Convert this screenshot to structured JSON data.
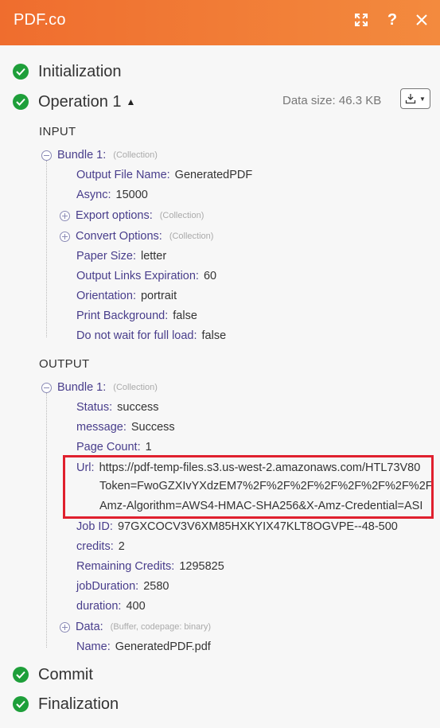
{
  "header": {
    "title": "PDF.co",
    "help_label": "?"
  },
  "steps": {
    "initialization": "Initialization",
    "operation": "Operation 1",
    "commit": "Commit",
    "finalization": "Finalization"
  },
  "operation": {
    "data_size": "Data size: 46.3 KB"
  },
  "input": {
    "section_label": "INPUT",
    "bundle_label": "Bundle 1:",
    "bundle_type": "(Collection)",
    "fields": [
      {
        "key": "Output File Name",
        "value": "GeneratedPDF"
      },
      {
        "key": "Async",
        "value": "15000"
      },
      {
        "key": "Export options",
        "type": "(Collection)"
      },
      {
        "key": "Convert Options",
        "type": "(Collection)"
      },
      {
        "key": "Paper Size ",
        "value": "letter"
      },
      {
        "key": "Output Links Expiration",
        "value": "60"
      },
      {
        "key": "Orientation",
        "value": "portrait"
      },
      {
        "key": "Print Background",
        "value": "false"
      },
      {
        "key": "Do not wait for full load",
        "value": "false"
      }
    ]
  },
  "output": {
    "section_label": "OUTPUT",
    "bundle_label": "Bundle 1:",
    "bundle_type": "(Collection)",
    "fields": [
      {
        "key": "Status",
        "value": "success"
      },
      {
        "key": "message",
        "value": "Success"
      },
      {
        "key": "Page Count",
        "value": "1"
      },
      {
        "key": "Url",
        "value": "https://pdf-temp-files.s3.us-west-2.amazonaws.com/HTL73V80"
      },
      {
        "key": "Job ID",
        "value": "97GXCOCV3V6XM85HXKYIX47KLT8OGVPE--48-500"
      },
      {
        "key": "credits",
        "value": "2"
      },
      {
        "key": "Remaining Credits",
        "value": "1295825"
      },
      {
        "key": "jobDuration",
        "value": "2580"
      },
      {
        "key": "duration",
        "value": "400"
      },
      {
        "key": "Data",
        "type": "(Buffer, codepage: binary)"
      },
      {
        "key": "Name",
        "value": "GeneratedPDF.pdf"
      }
    ],
    "url_continuation": [
      "Token=FwoGZXIvYXdzEM7%2F%2F%2F%2F%2F%2F%2F%2F%2",
      "Amz-Algorithm=AWS4-HMAC-SHA256&X-Amz-Credential=ASI"
    ]
  },
  "colors": {
    "header_start": "#ef6d2e",
    "header_end": "#f38a3e",
    "success": "#1e9f3a",
    "key": "#483d8b",
    "highlight": "#e0202e"
  }
}
